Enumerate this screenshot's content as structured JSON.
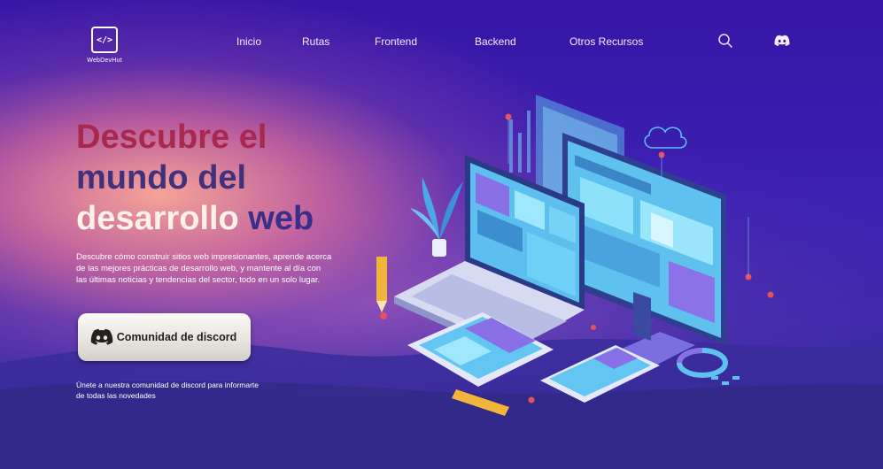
{
  "brand": {
    "name": "WebDevHut",
    "mark": "</>"
  },
  "nav": {
    "links": [
      "Inicio",
      "Rutas",
      "Frontend",
      "Backend",
      "Otros Recursos"
    ],
    "icons": [
      "search-icon",
      "discord-icon"
    ]
  },
  "hero": {
    "title_line1": "Descubre el",
    "title_line2": "mundo del",
    "title_line3a": "desarrollo ",
    "title_line3b": "web",
    "description": "Descubre cómo construir sitios web impresionantes, aprende acerca de las mejores prácticas de desarrollo web, y mantente al día con las últimas noticias y tendencias del sector, todo en un solo lugar.",
    "cta_label": "Comunidad de discord",
    "join_text": "Únete a nuestra comunidad de discord para informarte de todas las novedades"
  },
  "colors": {
    "title_red": "#a8284e",
    "title_purple": "#41307a",
    "background": "#3a1f9e"
  }
}
